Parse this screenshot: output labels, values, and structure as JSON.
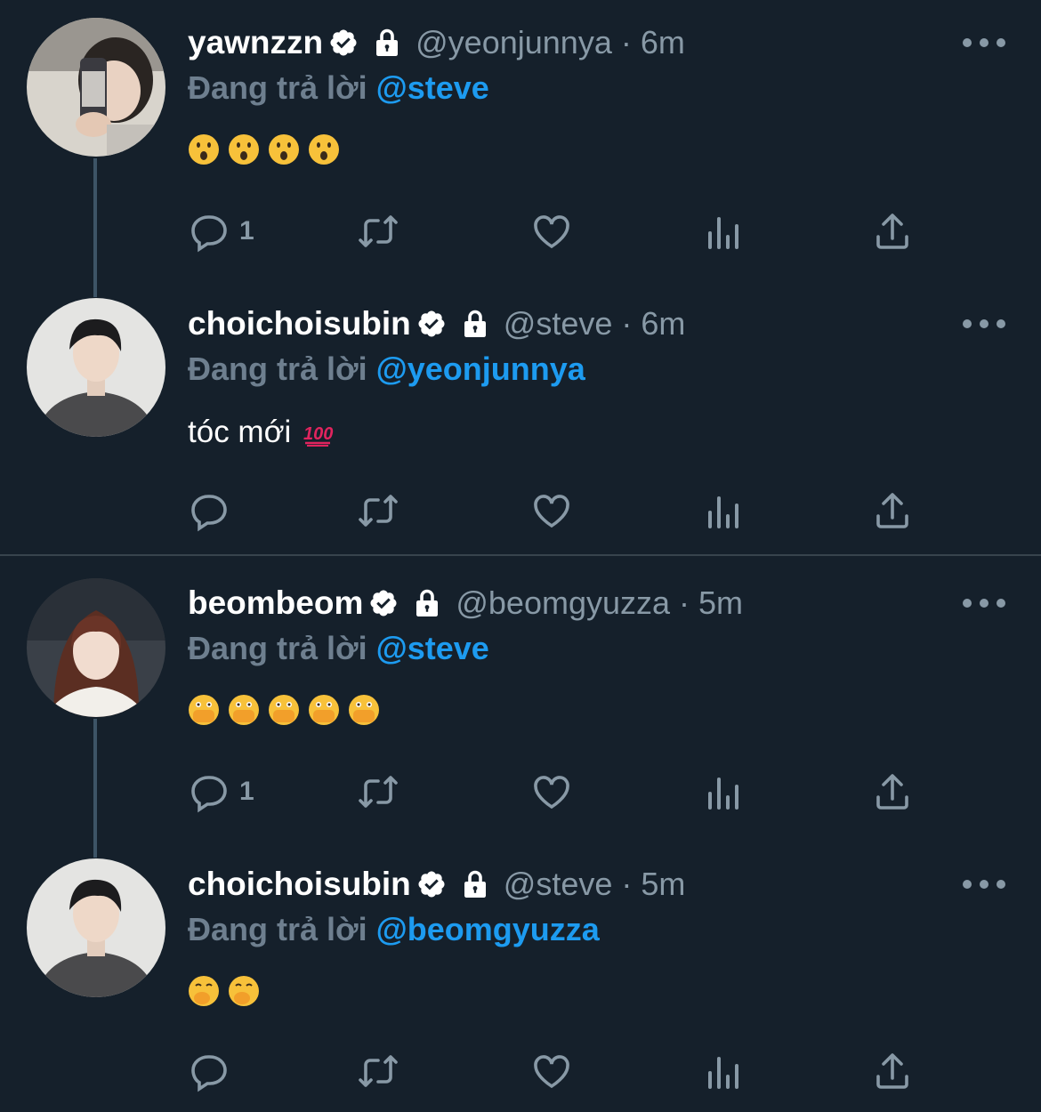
{
  "ui": {
    "background": "#15202b",
    "accent": "#1d9bf0",
    "muted": "#8899a6"
  },
  "tweets": [
    {
      "name": "yawnzzn",
      "handle": "@yeonjunnya",
      "time": "6m",
      "meta": "@yeonjunnya · 6m",
      "reply_prefix": "Đang trả lời",
      "reply_to": "@steve",
      "text": "",
      "emojis": [
        "hushed-face",
        "hushed-face",
        "hushed-face",
        "hushed-face"
      ],
      "reply_count": "1",
      "icons": [
        "verified-icon",
        "lock-icon",
        "more-icon",
        "reply-icon",
        "retweet-icon",
        "like-icon",
        "analytics-icon",
        "share-icon"
      ]
    },
    {
      "name": "choichoisubin",
      "handle": "@steve",
      "time": "6m",
      "meta": "@steve · 6m",
      "reply_prefix": "Đang trả lời",
      "reply_to": "@yeonjunnya",
      "text": "tóc mới",
      "emojis": [
        "hundred-points"
      ],
      "reply_count": ""
    },
    {
      "name": "beombeom",
      "handle": "@beomgyuzza",
      "time": "5m",
      "meta": "@beomgyuzza · 5m",
      "reply_prefix": "Đang trả lời",
      "reply_to": "@steve",
      "text": "",
      "emojis": [
        "face-with-open-eyes-and-hand-over-mouth",
        "face-with-open-eyes-and-hand-over-mouth",
        "face-with-open-eyes-and-hand-over-mouth",
        "face-with-open-eyes-and-hand-over-mouth",
        "face-with-open-eyes-and-hand-over-mouth"
      ],
      "reply_count": "1"
    },
    {
      "name": "choichoisubin",
      "handle": "@steve",
      "time": "5m",
      "meta": "@steve · 5m",
      "reply_prefix": "Đang trả lời",
      "reply_to": "@beomgyuzza",
      "text": "",
      "emojis": [
        "face-with-hand-over-mouth",
        "face-with-hand-over-mouth"
      ],
      "reply_count": ""
    }
  ]
}
